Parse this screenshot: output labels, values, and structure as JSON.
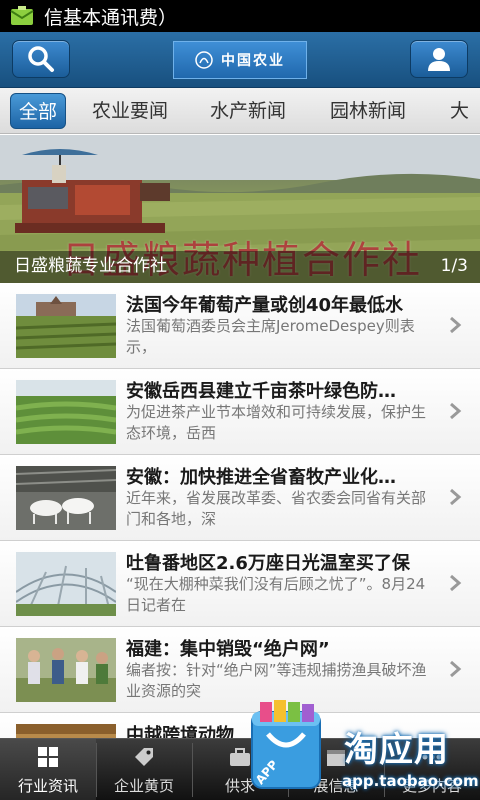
{
  "status": {
    "notification_text": "信基本通讯费）",
    "icon": "notification-mail-icon"
  },
  "header": {
    "logo_text": "中国农业",
    "search_icon": "search-icon",
    "user_icon": "user-icon"
  },
  "tabs": [
    {
      "label": "全部",
      "active": true
    },
    {
      "label": "农业要闻",
      "active": false
    },
    {
      "label": "水产新闻",
      "active": false
    },
    {
      "label": "园林新闻",
      "active": false
    },
    {
      "label": "大",
      "active": false
    }
  ],
  "banner": {
    "overlay_title": "日盛粮蔬种植合作社",
    "caption": "日盛粮蔬专业合作社",
    "pager": "1/3"
  },
  "news": [
    {
      "title": "法国今年葡萄产量或创40年最低水",
      "summary": "法国葡萄酒委员会主席JeromeDespey则表示，",
      "thumb": "vineyard"
    },
    {
      "title": "安徽岳西县建立千亩茶叶绿色防…",
      "summary": "为促进茶产业节本增效和可持续发展，保护生态环境，岳西",
      "thumb": "tea-field"
    },
    {
      "title": "安徽：加快推进全省畜牧产业化…",
      "summary": "近年来，省发展改革委、省农委会同省有关部门和各地，深",
      "thumb": "goats"
    },
    {
      "title": "吐鲁番地区2.6万座日光温室买了保",
      "summary": "“现在大棚种菜我们没有后顾之忧了”。8月24日记者在",
      "thumb": "greenhouse"
    },
    {
      "title": "福建：集中销毁“绝户网”",
      "summary": "编者按：针对“绝户网”等违规捕捞渔具破坏渔业资源的突",
      "thumb": "people"
    },
    {
      "title": "中越跨境动物",
      "summary": "",
      "thumb": "partial"
    }
  ],
  "tabbar": [
    {
      "label": "行业资讯",
      "icon": "grid-icon",
      "active": true
    },
    {
      "label": "企业黄页",
      "icon": "tag-icon",
      "active": false
    },
    {
      "label": "供求",
      "icon": "briefcase-icon",
      "active": false
    },
    {
      "label": "展信息",
      "icon": "calendar-icon",
      "active": false
    },
    {
      "label": "更多内容",
      "icon": "more-icon",
      "active": false
    }
  ],
  "watermark": {
    "title": "淘应用",
    "url": "app.taobao.com",
    "badge": "APP"
  },
  "colors": {
    "header_blue": "#1f5e95",
    "tab_active": "#2f7bbf",
    "banner_title": "#b3323a"
  }
}
